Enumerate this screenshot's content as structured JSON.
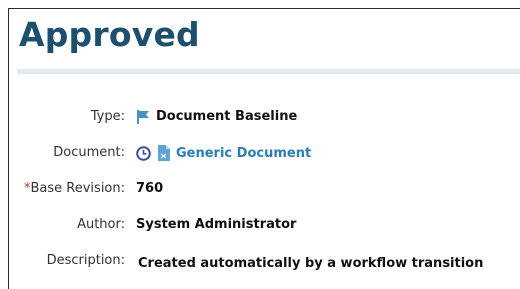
{
  "page": {
    "title": "Approved"
  },
  "fields": {
    "type": {
      "label": "Type:",
      "value": "Document Baseline",
      "icon": "flag-icon"
    },
    "document": {
      "label": "Document:",
      "value": "Generic Document",
      "icons": [
        "clock-icon",
        "document-icon"
      ]
    },
    "base_revision": {
      "required_mark": "*",
      "label": "Base Revision:",
      "value": "760"
    },
    "author": {
      "label": "Author:",
      "value": "System Administrator"
    },
    "description": {
      "label": "Description:",
      "value": "Created automatically by a workflow transition"
    }
  },
  "colors": {
    "title": "#1d4f6e",
    "link": "#2a7fb0",
    "required": "#c0392b",
    "rule": "#e3e9ef"
  }
}
